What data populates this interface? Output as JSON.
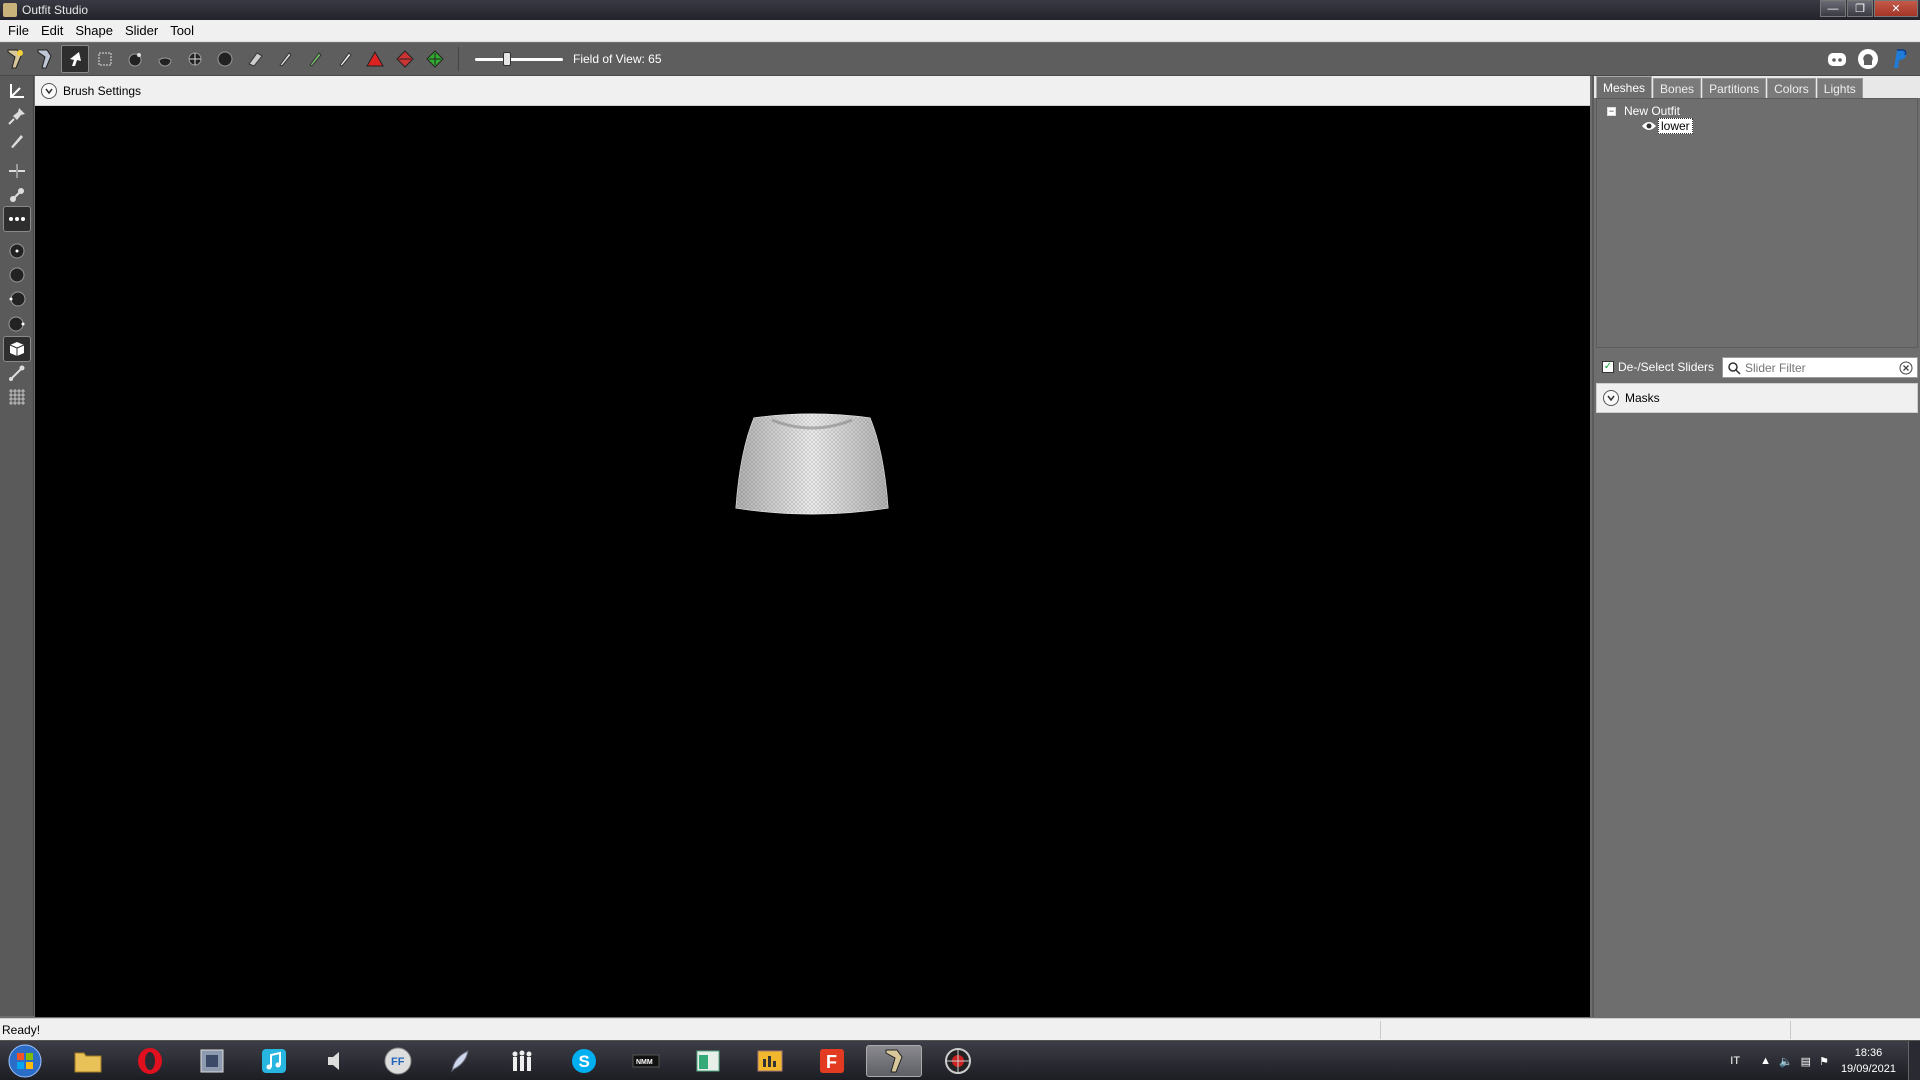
{
  "window": {
    "title": "Outfit Studio"
  },
  "menu": {
    "items": [
      "File",
      "Edit",
      "Shape",
      "Slider",
      "Tool"
    ]
  },
  "toolbar": {
    "fov_label": "Field of View: 65",
    "fov_value": 65
  },
  "brush_settings": {
    "title": "Brush Settings"
  },
  "right_panel": {
    "tabs": [
      "Meshes",
      "Bones",
      "Partitions",
      "Colors",
      "Lights"
    ],
    "active_tab": "Meshes",
    "tree": {
      "root": "New Outfit",
      "child": "lower"
    },
    "deselect_label": "De-/Select Sliders",
    "slider_filter_placeholder": "Slider Filter",
    "masks_label": "Masks"
  },
  "status": {
    "text": "Ready!"
  },
  "taskbar": {
    "tray_lang": "IT",
    "time": "18:36",
    "date": "19/09/2021"
  },
  "colors": {
    "viewport": "#000000",
    "panel": "#6e6e6e",
    "toolbar": "#5e5e5e"
  }
}
